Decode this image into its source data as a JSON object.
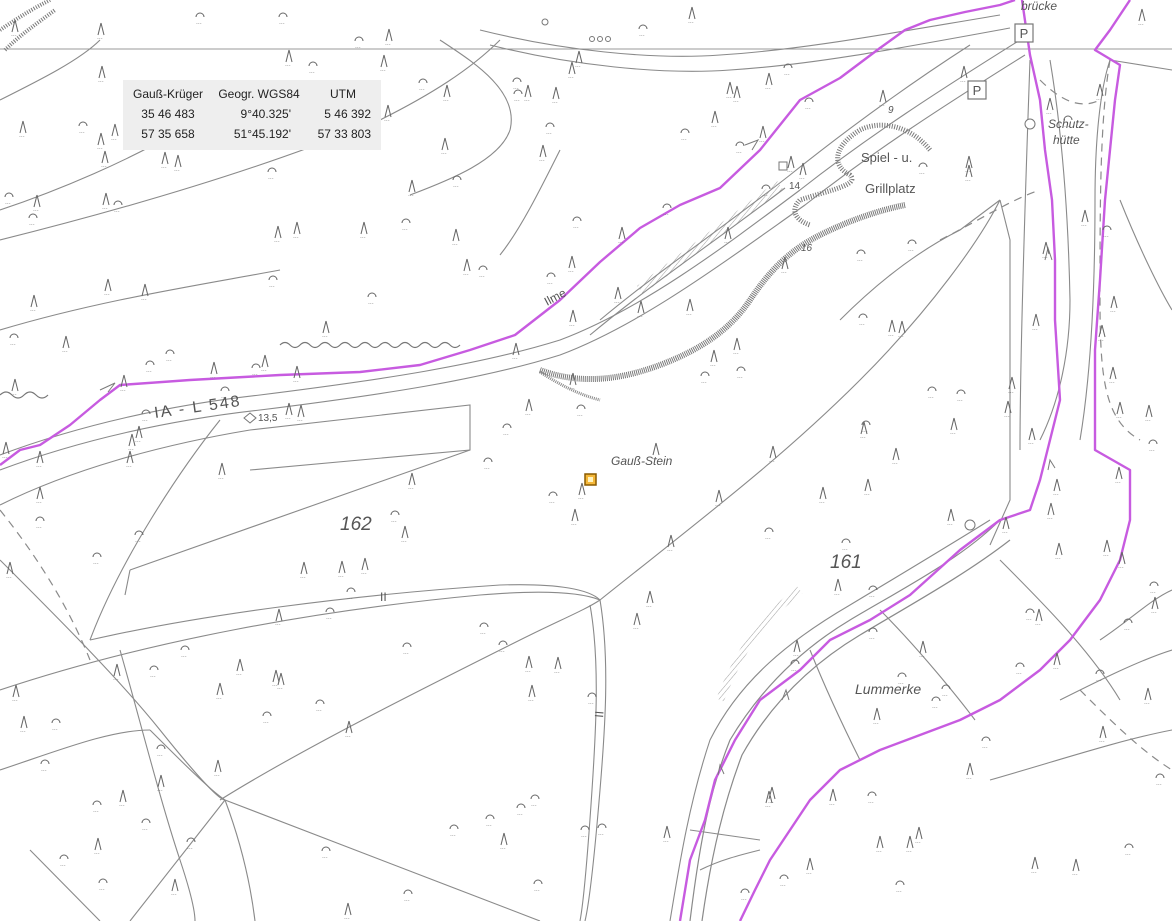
{
  "map": {
    "labels": {
      "gauss_stein": "Gauß-Stein",
      "parcel_162": "162",
      "parcel_161": "161",
      "lummerke": "Lummerke",
      "spiel": "Spiel - u.",
      "grillplatz": "Grillplatz",
      "schutz": "Schutz-",
      "huette": "hütte",
      "bruecke": "brücke",
      "road_label": "IA - L 548",
      "river": "Ilme",
      "height_135": "13,5",
      "num_9": "9",
      "num_14": "14",
      "num_16": "16",
      "parking_symbol": "P",
      "path_mark_1": "II",
      "path_mark_2": "II"
    },
    "colors": {
      "route": "#c75be0",
      "linework": "#8a8a8a",
      "marker_fill": "#f5b83a",
      "marker_border": "#8a5a00"
    }
  },
  "coord_panel": {
    "headers": [
      "Gauß-Krüger",
      "Geogr. WGS84",
      "UTM"
    ],
    "rows": [
      [
        "35 46 483",
        "9°40.325'",
        "5 46 392"
      ],
      [
        "57 35 658",
        "51°45.192'",
        "57 33 803"
      ]
    ]
  }
}
